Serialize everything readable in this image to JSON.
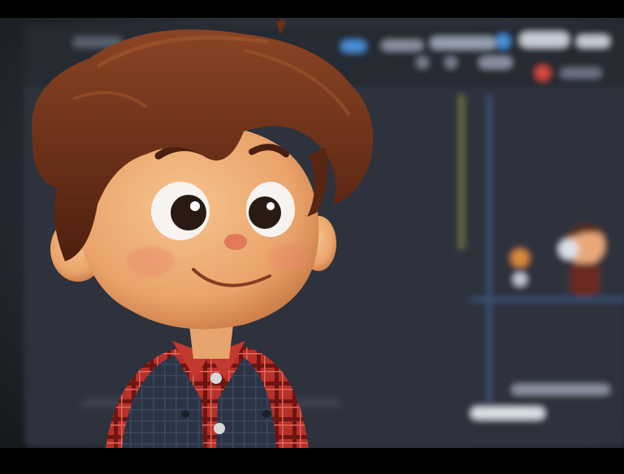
{
  "image": {
    "scene": "cartoon-boy-in-front-of-monitor",
    "colors": {
      "background_dark": "#2a2e36",
      "monitor_bar": "#5a6270",
      "accent_blue": "#4a90d9",
      "accent_red": "#d94a3a",
      "hair": "#6b2e16",
      "skin": "#f0b27a",
      "shirt_red": "#b8302a",
      "vest": "#2b3445"
    }
  }
}
